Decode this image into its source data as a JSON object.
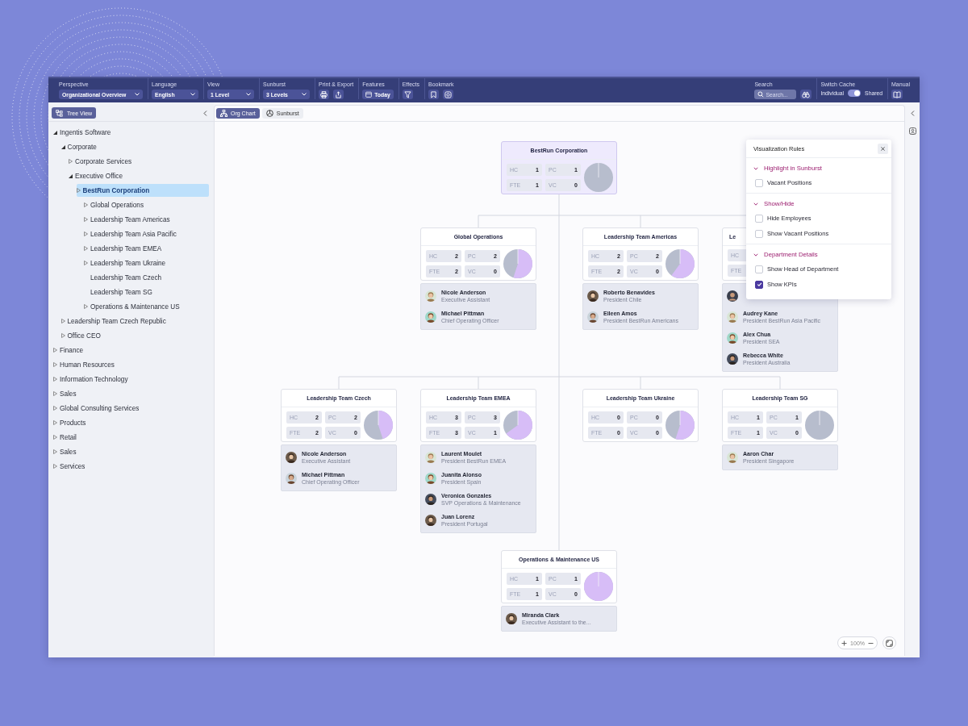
{
  "toolbar": [
    {
      "kind": "dropdown",
      "label": "Perspective",
      "value": "Organizational Overview"
    },
    {
      "kind": "dropdown",
      "label": "Language",
      "value": "English"
    },
    {
      "kind": "dropdown",
      "label": "View",
      "value": "1 Level"
    },
    {
      "kind": "dropdown",
      "label": "Sunburst",
      "value": "3 Levels"
    },
    {
      "kind": "print",
      "label": "Print & Export"
    },
    {
      "kind": "features",
      "label": "Features",
      "button": "Today"
    },
    {
      "kind": "effects",
      "label": "Effects"
    },
    {
      "kind": "bookmark",
      "label": "Bookmark"
    }
  ],
  "toolbar_right": [
    {
      "kind": "search",
      "label": "Search",
      "placeholder": "Search..."
    },
    {
      "kind": "cache",
      "label": "Switch Cache",
      "left": "Individual",
      "right": "Shared",
      "on": true
    },
    {
      "kind": "manual",
      "label": "Manual"
    }
  ],
  "tree_panel": {
    "button": "Tree View",
    "items": [
      {
        "label": "Ingentis Software",
        "expandable": true,
        "expanded": true,
        "selected": false,
        "children": [
          {
            "label": "Corporate",
            "expandable": true,
            "expanded": true,
            "selected": false,
            "children": [
              {
                "label": "Corporate Services",
                "expandable": true,
                "expanded": false,
                "selected": false
              },
              {
                "label": "Executive Office",
                "expandable": true,
                "expanded": true,
                "selected": false,
                "children": [
                  {
                    "label": "BestRun Corporation",
                    "expandable": true,
                    "expanded": false,
                    "selected": true,
                    "children": [
                      {
                        "label": "Global Operations",
                        "expandable": true,
                        "expanded": false,
                        "selected": false
                      },
                      {
                        "label": "Leadership Team Americas",
                        "expandable": true,
                        "expanded": false,
                        "selected": false
                      },
                      {
                        "label": "Leadership Team Asia Pacific",
                        "expandable": true,
                        "expanded": false,
                        "selected": false
                      },
                      {
                        "label": "Leadership Team EMEA",
                        "expandable": true,
                        "expanded": false,
                        "selected": false
                      },
                      {
                        "label": "Leadership Team Ukraine",
                        "expandable": true,
                        "expanded": false,
                        "selected": false
                      },
                      {
                        "label": "Leadership Team Czech",
                        "expandable": false,
                        "selected": false
                      },
                      {
                        "label": "Leadership Team SG",
                        "expandable": false,
                        "selected": false
                      },
                      {
                        "label": "Operations & Maintenance US",
                        "expandable": true,
                        "expanded": false,
                        "selected": false
                      }
                    ]
                  }
                ]
              }
            ]
          },
          {
            "label": "Leadership Team Czech Republic",
            "expandable": true,
            "expanded": false,
            "selected": false
          },
          {
            "label": "Office CEO",
            "expandable": true,
            "expanded": false,
            "selected": false
          }
        ]
      },
      {
        "label": "Finance",
        "expandable": true,
        "expanded": false,
        "selected": false
      },
      {
        "label": "Human Resources",
        "expandable": true,
        "expanded": false,
        "selected": false
      },
      {
        "label": "Information Technology",
        "expandable": true,
        "expanded": false,
        "selected": false
      },
      {
        "label": "Sales",
        "expandable": true,
        "expanded": false,
        "selected": false
      },
      {
        "label": "Global Consulting Services",
        "expandable": true,
        "expanded": false,
        "selected": false
      },
      {
        "label": "Products",
        "expandable": true,
        "expanded": false,
        "selected": false
      },
      {
        "label": "Retail",
        "expandable": true,
        "expanded": false,
        "selected": false
      },
      {
        "label": "Sales",
        "expandable": true,
        "expanded": false,
        "selected": false
      },
      {
        "label": "Services",
        "expandable": true,
        "expanded": false,
        "selected": false
      }
    ]
  },
  "view_tabs": [
    {
      "label": "Org Chart",
      "selected": true
    },
    {
      "label": "Sunburst",
      "selected": false
    }
  ],
  "nodes": [
    {
      "title": "BestRun Corporation",
      "selected": true,
      "clipped": false,
      "kpis": [
        {
          "label": "HC",
          "value": "1"
        },
        {
          "label": "FTE",
          "value": "1"
        },
        {
          "label": "PC",
          "value": "1"
        },
        {
          "label": "VC",
          "value": "0"
        }
      ]
    },
    {
      "title": "Global Operations",
      "selected": false,
      "clipped": false,
      "kpis": [
        {
          "label": "HC",
          "value": "2"
        },
        {
          "label": "FTE",
          "value": "2"
        },
        {
          "label": "PC",
          "value": "2"
        },
        {
          "label": "VC",
          "value": "0"
        }
      ],
      "employees": [
        {
          "name": "Nicole Anderson",
          "role": "Executive Assistant"
        },
        {
          "name": "Michael Pittman",
          "role": "Chief Operating Officer"
        }
      ]
    },
    {
      "title": "Leadership Team Americas",
      "selected": false,
      "clipped": false,
      "kpis": [
        {
          "label": "HC",
          "value": "2"
        },
        {
          "label": "FTE",
          "value": "2"
        },
        {
          "label": "PC",
          "value": "2"
        },
        {
          "label": "VC",
          "value": "0"
        }
      ],
      "employees": [
        {
          "name": "Roberto Benavides",
          "role": "President Chile"
        },
        {
          "name": "Eileen Amos",
          "role": "President BestRun Americans"
        }
      ]
    },
    {
      "title": "Le",
      "selected": false,
      "clipped": true,
      "kpis": [
        {
          "label": "HC"
        },
        {
          "label": "FTE"
        }
      ],
      "employees": [
        {
          "name": "Audrey Kane",
          "role": "President BestRun Asia Pacific"
        },
        {
          "name": "Alex Chua",
          "role": "President SEA"
        },
        {
          "name": "Rebecca White",
          "role": "President Australia"
        }
      ]
    },
    {
      "title": "Leadership Team Czech",
      "selected": false,
      "clipped": false,
      "kpis": [
        {
          "label": "HC",
          "value": "2"
        },
        {
          "label": "FTE",
          "value": "2"
        },
        {
          "label": "PC",
          "value": "2"
        },
        {
          "label": "VC",
          "value": "0"
        }
      ],
      "employees": [
        {
          "name": "Nicole Anderson",
          "role": "Executive Assistant"
        },
        {
          "name": "Michael Pittman",
          "role": "Chief Operating Officer"
        }
      ]
    },
    {
      "title": "Leadership Team EMEA",
      "selected": false,
      "clipped": false,
      "kpis": [
        {
          "label": "HC",
          "value": "3"
        },
        {
          "label": "FTE",
          "value": "3"
        },
        {
          "label": "PC",
          "value": "3"
        },
        {
          "label": "VC",
          "value": "1"
        }
      ],
      "employees": [
        {
          "name": "Laurent Moulet",
          "role": "President BestRun EMEA"
        },
        {
          "name": "Juanita Alonso",
          "role": "President Spain"
        },
        {
          "name": "Veronica Gonzales",
          "role": "SVP Operations & Maintenance"
        },
        {
          "name": "Juan Lorenz",
          "role": "President Portugal"
        }
      ]
    },
    {
      "title": "Leadership Team Ukraine",
      "selected": false,
      "clipped": false,
      "kpis": [
        {
          "label": "HC",
          "value": "0"
        },
        {
          "label": "FTE",
          "value": "0"
        },
        {
          "label": "PC",
          "value": "0"
        },
        {
          "label": "VC",
          "value": "0"
        }
      ]
    },
    {
      "title": "Leadership Team SG",
      "selected": false,
      "clipped": false,
      "kpis": [
        {
          "label": "HC",
          "value": "1"
        },
        {
          "label": "FTE",
          "value": "1"
        },
        {
          "label": "PC",
          "value": "1"
        },
        {
          "label": "VC",
          "value": "0"
        }
      ],
      "employees": [
        {
          "name": "Aaron Char",
          "role": "President Singapore"
        }
      ]
    },
    {
      "title": "Operations & Maintenance US",
      "selected": false,
      "clipped": false,
      "kpis": [
        {
          "label": "HC",
          "value": "1"
        },
        {
          "label": "FTE",
          "value": "1"
        },
        {
          "label": "PC",
          "value": "1"
        },
        {
          "label": "VC",
          "value": "0"
        }
      ],
      "employees": [
        {
          "name": "Miranda Clark",
          "role": "Executive Assistant to the..."
        }
      ]
    }
  ],
  "rules_panel": {
    "title": "Visualization Rules",
    "sections": [
      {
        "title": "Highlight in Sunburst",
        "expanded": true,
        "options": [
          {
            "label": "Vacant Positions",
            "checked": false
          }
        ]
      },
      {
        "title": "Show/Hide",
        "expanded": true,
        "options": [
          {
            "label": "Hide Employees",
            "checked": false
          },
          {
            "label": "Show Vacant Positions",
            "checked": false
          }
        ]
      },
      {
        "title": "Department Details",
        "expanded": true,
        "options": [
          {
            "label": "Show Head of Department",
            "checked": false
          },
          {
            "label": "Show KPIs",
            "checked": true
          }
        ]
      }
    ]
  },
  "zoom": {
    "value": "100%"
  }
}
